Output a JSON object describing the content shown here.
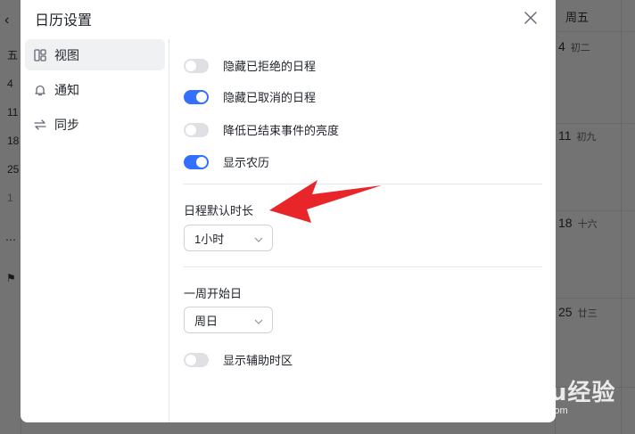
{
  "dialog": {
    "title": "日历设置",
    "nav": [
      {
        "label": "视图",
        "icon": "layout-grid-icon",
        "active": true
      },
      {
        "label": "通知",
        "icon": "bell-icon",
        "active": false
      },
      {
        "label": "同步",
        "icon": "sync-arrows-icon",
        "active": false
      }
    ],
    "view_settings": {
      "toggles": [
        {
          "label": "隐藏已拒绝的日程",
          "on": false
        },
        {
          "label": "隐藏已取消的日程",
          "on": true
        },
        {
          "label": "降低已结束事件的亮度",
          "on": false
        },
        {
          "label": "显示农历",
          "on": true
        }
      ],
      "default_duration": {
        "label": "日程默认时长",
        "value": "1小时"
      },
      "week_start": {
        "label": "一周开始日",
        "value": "周日"
      },
      "secondary_timezone": {
        "label": "显示辅助时区",
        "on": false
      }
    }
  },
  "background": {
    "left_column": {
      "weekday": "五",
      "days": [
        "4",
        "11",
        "18",
        "25",
        "1"
      ]
    },
    "right_column": {
      "header": "周五",
      "days": [
        {
          "day": "4",
          "lunar": "初二"
        },
        {
          "day": "11",
          "lunar": "初九"
        },
        {
          "day": "18",
          "lunar": "十六"
        },
        {
          "day": "25",
          "lunar": "廿三"
        }
      ]
    }
  },
  "watermark": {
    "brand": "Baidu经验",
    "url": "jingyan.baidu.com"
  },
  "colors": {
    "accent": "#3370ff",
    "annotation_arrow": "#e8262a"
  }
}
